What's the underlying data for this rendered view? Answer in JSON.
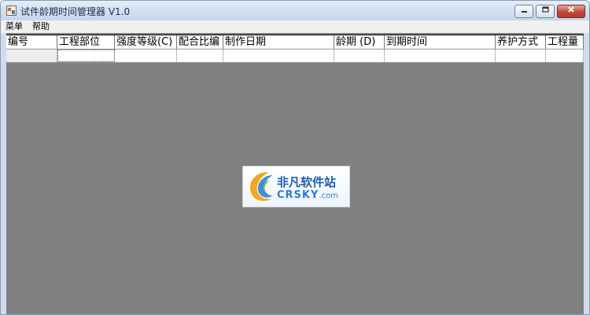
{
  "window": {
    "title": "试件龄期时间管理器 V1.0"
  },
  "menu": {
    "items": [
      "菜单",
      "帮助"
    ]
  },
  "grid": {
    "columns": [
      "编号",
      "工程部位",
      "强度等级(C)",
      "配合比编",
      "制作日期",
      "龄期 (D)",
      "到期时间",
      "养护方式",
      "工程量"
    ]
  },
  "watermark": {
    "line1": "非凡软件站",
    "line2": "CRSKY",
    "line2_domain": ".com"
  },
  "colors": {
    "client_bg": "#808080",
    "title_gradient": "#d3e1f2",
    "close_button": "#c2473a"
  }
}
